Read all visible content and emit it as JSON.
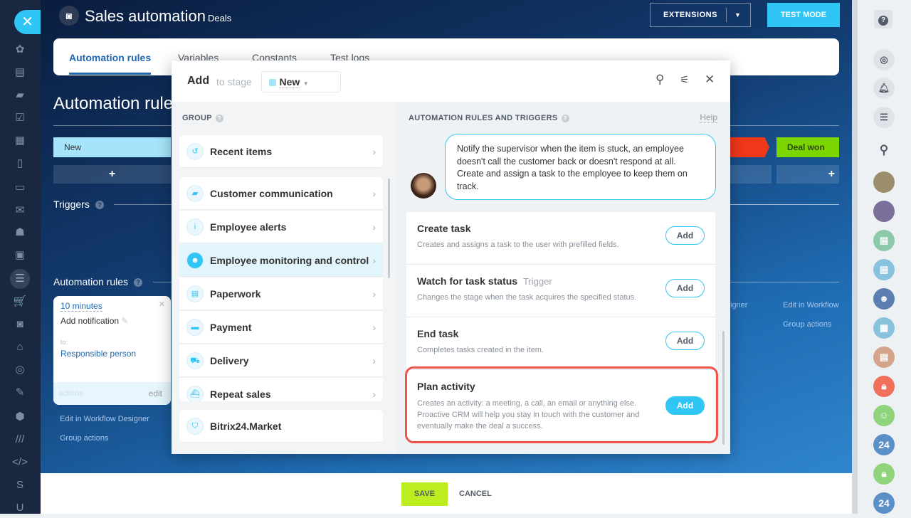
{
  "header": {
    "title": "Sales automation",
    "subtitle": "Deals",
    "extensions": "EXTENSIONS",
    "test_mode": "TEST MODE"
  },
  "tabs": [
    "Automation rules",
    "Variables",
    "Constants",
    "Test logs"
  ],
  "page": {
    "heading": "Automation rules",
    "stages": [
      "New",
      "Deal won"
    ],
    "plus": "+",
    "triggers": "Triggers",
    "rules": "Automation rules",
    "help": "?"
  },
  "rule_card": {
    "delay": "10 minutes",
    "action": "Add notification",
    "to_label": "to:",
    "to": "Responsible person",
    "actions": "actions",
    "edit": "edit"
  },
  "links": {
    "designer": "Edit in Workflow Designer",
    "designer_cut": "Edit in Workflow",
    "designer_tail": "igner",
    "group": "Group actions"
  },
  "leftbar": {
    "letters": [
      "S",
      "U"
    ]
  },
  "rightbar": {
    "help": "?",
    "badges": [
      "24",
      "24"
    ]
  },
  "modal": {
    "title": "Add",
    "to_stage": "to stage",
    "stage": "New",
    "group_label": "GROUP",
    "groups": [
      {
        "label": "Recent items",
        "icon": "history-icon"
      },
      {
        "label": "Customer communication",
        "icon": "chat-icon"
      },
      {
        "label": "Employee alerts",
        "icon": "info-icon"
      },
      {
        "label": "Employee monitoring and control",
        "icon": "people-icon"
      },
      {
        "label": "Paperwork",
        "icon": "document-icon"
      },
      {
        "label": "Payment",
        "icon": "wallet-icon"
      },
      {
        "label": "Delivery",
        "icon": "truck-icon"
      },
      {
        "label": "Repeat sales",
        "icon": "ship-icon"
      }
    ],
    "market": "Bitrix24.Market",
    "rules_label": "AUTOMATION RULES AND TRIGGERS",
    "help": "Help",
    "hint": "Notify the supervisor when the item is stuck, an employee doesn't call the customer back or doesn't respond at all. Create and assign a task to the employee to keep them on track.",
    "items": [
      {
        "title": "Create task",
        "tag": "",
        "desc": "Creates and assigns a task to the user with prefilled fields.",
        "button": "Add"
      },
      {
        "title": "Watch for task status",
        "tag": "Trigger",
        "desc": "Changes the stage when the task acquires the specified status.",
        "button": "Add"
      },
      {
        "title": "End task",
        "tag": "",
        "desc": "Completes tasks created in the item.",
        "button": "Add"
      },
      {
        "title": "Plan activity",
        "tag": "",
        "desc": "Creates an activity: a meeting, a call, an email or anything else. Proactive CRM will help you stay in touch with the customer and eventually make the deal a success.",
        "button": "Add"
      }
    ]
  },
  "footer": {
    "save": "SAVE",
    "cancel": "CANCEL"
  },
  "colors": {
    "accent": "#2fc6f6",
    "save": "#bbed21",
    "deal_won": "#7bd500",
    "highlight": "#f0544c",
    "stage_new": "#a5e4fa"
  }
}
